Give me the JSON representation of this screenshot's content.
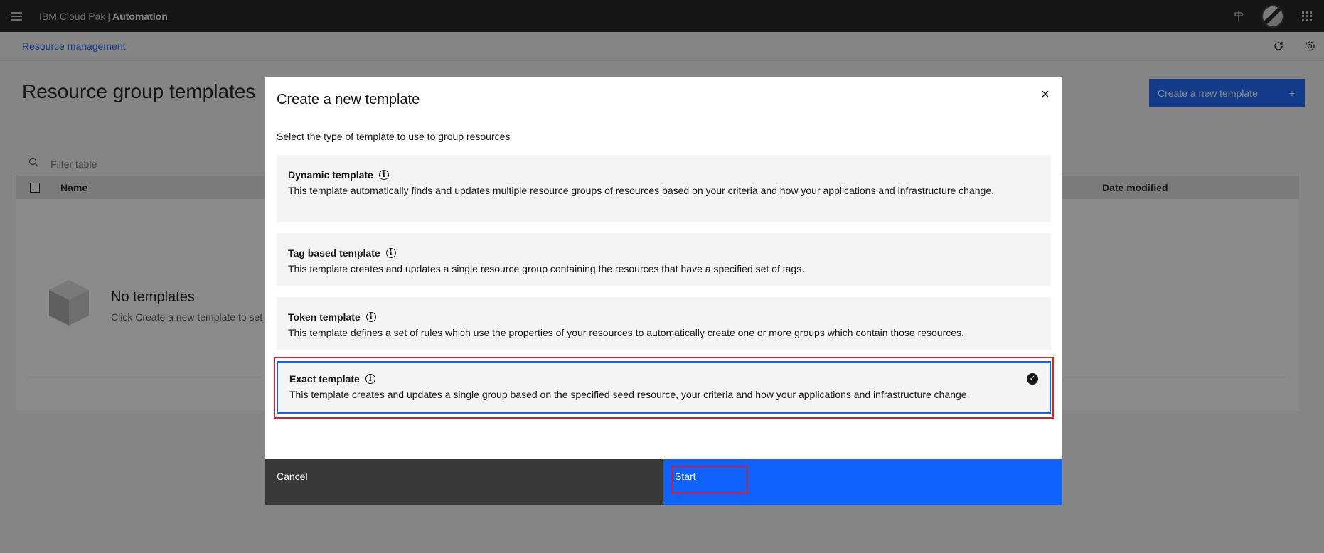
{
  "header": {
    "menu_icon": "hamburger-icon",
    "brand_prefix": "IBM Cloud Pak",
    "brand_separator": "|",
    "brand_product": "Automation",
    "icons": [
      "signpost-icon",
      "avatar",
      "app-switcher-icon"
    ]
  },
  "breadcrumb": {
    "label": "Resource management",
    "icons": [
      "refresh-icon",
      "settings-icon"
    ]
  },
  "page": {
    "title": "Resource group templates",
    "create_button_label": "Create a new template",
    "create_button_icon": "+"
  },
  "table": {
    "search_placeholder": "Filter table",
    "columns": [
      "Name",
      "Date modified"
    ],
    "empty_title": "No templates",
    "empty_subtitle": "Click Create a new template to set"
  },
  "modal": {
    "title": "Create a new template",
    "close_icon": "×",
    "subtitle": "Select the type of template to use to group resources",
    "info_glyph": "i",
    "check_glyph": "✓",
    "options": [
      {
        "title": "Dynamic template",
        "description": "This template automatically finds and updates multiple resource groups of resources based on your criteria and how your applications and infrastructure change.",
        "selected": false
      },
      {
        "title": "Tag based template",
        "description": "This template creates and updates a single resource group containing the resources that have a specified set of tags.",
        "selected": false
      },
      {
        "title": "Token template",
        "description": "This template defines a set of rules which use the properties of your resources to automatically create one or more groups which contain those resources.",
        "selected": false
      },
      {
        "title": "Exact template",
        "description": "This template creates and updates a single group based on the specified seed resource, your criteria and how your applications and infrastructure change.",
        "selected": true
      }
    ],
    "cancel_label": "Cancel",
    "start_label": "Start"
  },
  "colors": {
    "primary": "#0f62fe",
    "header_bg": "#161616",
    "highlight": "#da1e28"
  }
}
